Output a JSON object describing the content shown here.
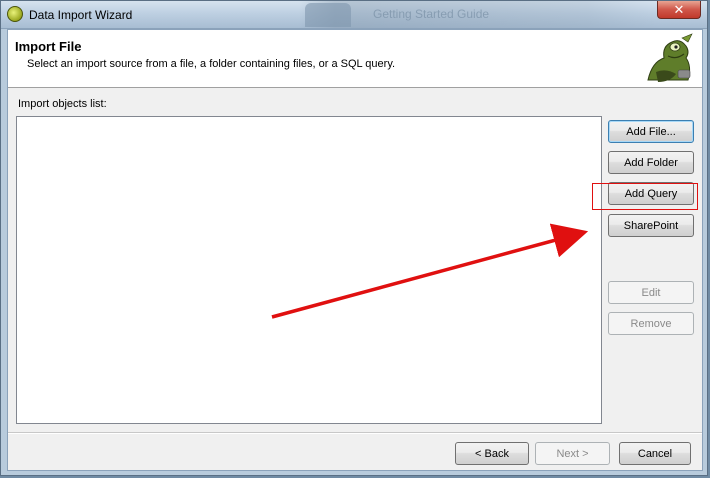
{
  "window": {
    "title": "Data Import Wizard",
    "close_label": "✕",
    "background_window_title": "Getting Started Guide"
  },
  "header": {
    "title": "Import File",
    "subtitle": "Select an import source from a file, a folder containing files, or a SQL query."
  },
  "list": {
    "label": "Import objects list:",
    "items": []
  },
  "side_buttons": {
    "add_file": "Add File...",
    "add_folder": "Add Folder",
    "add_query": "Add Query",
    "sharepoint": "SharePoint",
    "edit": "Edit",
    "remove": "Remove"
  },
  "footer_buttons": {
    "back": "< Back",
    "next": "Next >",
    "cancel": "Cancel"
  },
  "annotation": {
    "highlight_color": "#e01010",
    "arrow_color": "#e01010",
    "target": "SharePoint"
  }
}
